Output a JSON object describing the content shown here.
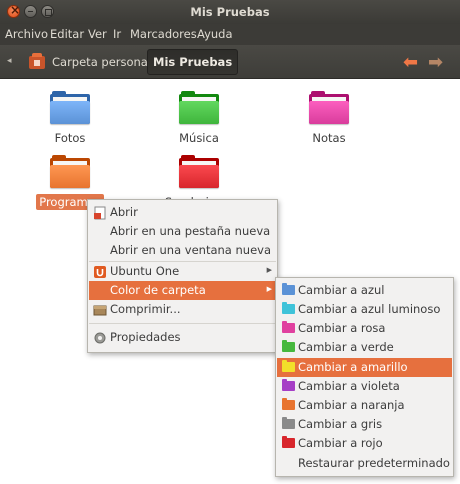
{
  "window": {
    "title": "Mis Pruebas"
  },
  "menubar": {
    "items": [
      "Archivo",
      "Editar",
      "Ver",
      "Ir",
      "Marcadores",
      "Ayuda"
    ]
  },
  "pathbar": {
    "home_label": "Carpeta personal",
    "current_label": "Mis Pruebas"
  },
  "files": [
    {
      "name": "Fotos",
      "color": "#5b92d6"
    },
    {
      "name": "Música",
      "color": "#3fb53c"
    },
    {
      "name": "Notas",
      "color": "#d93c9c"
    },
    {
      "name": "Programas",
      "color": "#e8742f"
    },
    {
      "name": "Senderismo",
      "color": "#d8262c"
    }
  ],
  "context_menu": {
    "items": [
      {
        "label": "Abrir",
        "icon": "open-icon"
      },
      {
        "label": "Abrir en una pestaña nueva"
      },
      {
        "label": "Abrir en una ventana nueva"
      },
      {
        "label": "Ubuntu One",
        "icon": "ubuntu-one-icon"
      },
      {
        "label": "Color de carpeta",
        "highlighted": true
      },
      {
        "label": "Comprimir...",
        "icon": "archive-icon"
      },
      {
        "label": "Propiedades",
        "icon": "properties-icon"
      }
    ]
  },
  "color_submenu": {
    "items": [
      {
        "label": "Cambiar a azul",
        "color": "#5b92d6"
      },
      {
        "label": "Cambiar a azul luminoso",
        "color": "#3fc3d9"
      },
      {
        "label": "Cambiar a rosa",
        "color": "#e0409f"
      },
      {
        "label": "Cambiar a verde",
        "color": "#46b83e"
      },
      {
        "label": "Cambiar a amarillo",
        "color": "#f2e02a",
        "highlighted": true
      },
      {
        "label": "Cambiar a violeta",
        "color": "#a63fc6"
      },
      {
        "label": "Cambiar a naranja",
        "color": "#e8742f"
      },
      {
        "label": "Cambiar a gris",
        "color": "#8a8a8a"
      },
      {
        "label": "Cambiar a rojo",
        "color": "#d8262c"
      },
      {
        "label": "Restaurar predeterminado"
      }
    ]
  }
}
